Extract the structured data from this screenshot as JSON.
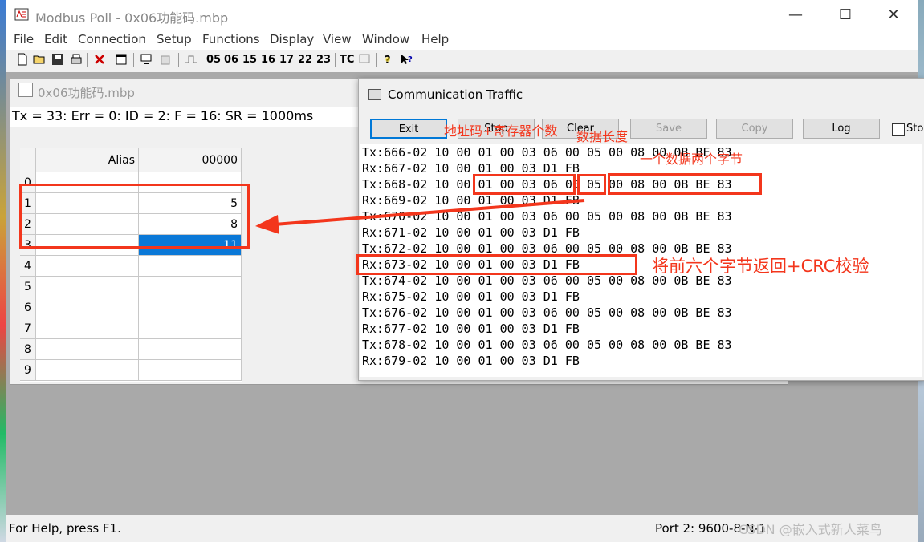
{
  "app": {
    "title": "Modbus Poll - 0x06功能码.mbp",
    "minimize": "—",
    "maximize": "☐",
    "close": "✕"
  },
  "menu": [
    "File",
    "Edit",
    "Connection",
    "Setup",
    "Functions",
    "Display",
    "View",
    "Window",
    "Help"
  ],
  "toolbar": {
    "function_buttons": [
      "05",
      "06",
      "15",
      "16",
      "17",
      "22",
      "23",
      "TC"
    ]
  },
  "child": {
    "title": "0x06功能码.mbp",
    "status": "Tx = 33: Err = 0: ID = 2: F = 16: SR = 1000ms",
    "grid": {
      "col_headers": [
        "Alias",
        "00000"
      ],
      "rows": [
        {
          "n": "0",
          "alias": "",
          "value": ""
        },
        {
          "n": "1",
          "alias": "",
          "value": "5"
        },
        {
          "n": "2",
          "alias": "",
          "value": "8"
        },
        {
          "n": "3",
          "alias": "",
          "value": "11"
        },
        {
          "n": "4",
          "alias": "",
          "value": ""
        },
        {
          "n": "5",
          "alias": "",
          "value": ""
        },
        {
          "n": "6",
          "alias": "",
          "value": ""
        },
        {
          "n": "7",
          "alias": "",
          "value": ""
        },
        {
          "n": "8",
          "alias": "",
          "value": ""
        },
        {
          "n": "9",
          "alias": "",
          "value": ""
        }
      ]
    }
  },
  "traffic": {
    "title": "Communication Traffic",
    "buttons": [
      "Exit",
      "Stop",
      "Clear",
      "Save",
      "Copy",
      "Log"
    ],
    "stop_checkbox": "Stop",
    "lines": [
      "Tx:666-02 10 00 01 00 03 06 00 05 00 08 00 0B BE 83",
      "Rx:667-02 10 00 01 00 03 D1 FB",
      "Tx:668-02 10 00 01 00 03 06 00 05 00 08 00 0B BE 83",
      "Rx:669-02 10 00 01 00 03 D1 FB",
      "Tx:670-02 10 00 01 00 03 06 00 05 00 08 00 0B BE 83",
      "Rx:671-02 10 00 01 00 03 D1 FB",
      "Tx:672-02 10 00 01 00 03 06 00 05 00 08 00 0B BE 83",
      "Rx:673-02 10 00 01 00 03 D1 FB",
      "Tx:674-02 10 00 01 00 03 06 00 05 00 08 00 0B BE 83",
      "Rx:675-02 10 00 01 00 03 D1 FB",
      "Tx:676-02 10 00 01 00 03 06 00 05 00 08 00 0B BE 83",
      "Rx:677-02 10 00 01 00 03 D1 FB",
      "Tx:678-02 10 00 01 00 03 06 00 05 00 08 00 0B BE 83",
      "Rx:679-02 10 00 01 00 03 D1 FB"
    ]
  },
  "annotations": {
    "addr_regcount": "地址码+寄存器个数",
    "data_length": "数据长度",
    "two_bytes_per": "一个数据两个字节",
    "return_crc": "将前六个字节返回+CRC校验"
  },
  "statusbar": {
    "help": "For Help, press F1.",
    "port": "Port 2: 9600-8-N-1",
    "watermark": "CSDN @嵌入式新人菜鸟"
  },
  "colors": {
    "annotation_red": "#f3361c",
    "selection_blue": "#0a78d7"
  }
}
